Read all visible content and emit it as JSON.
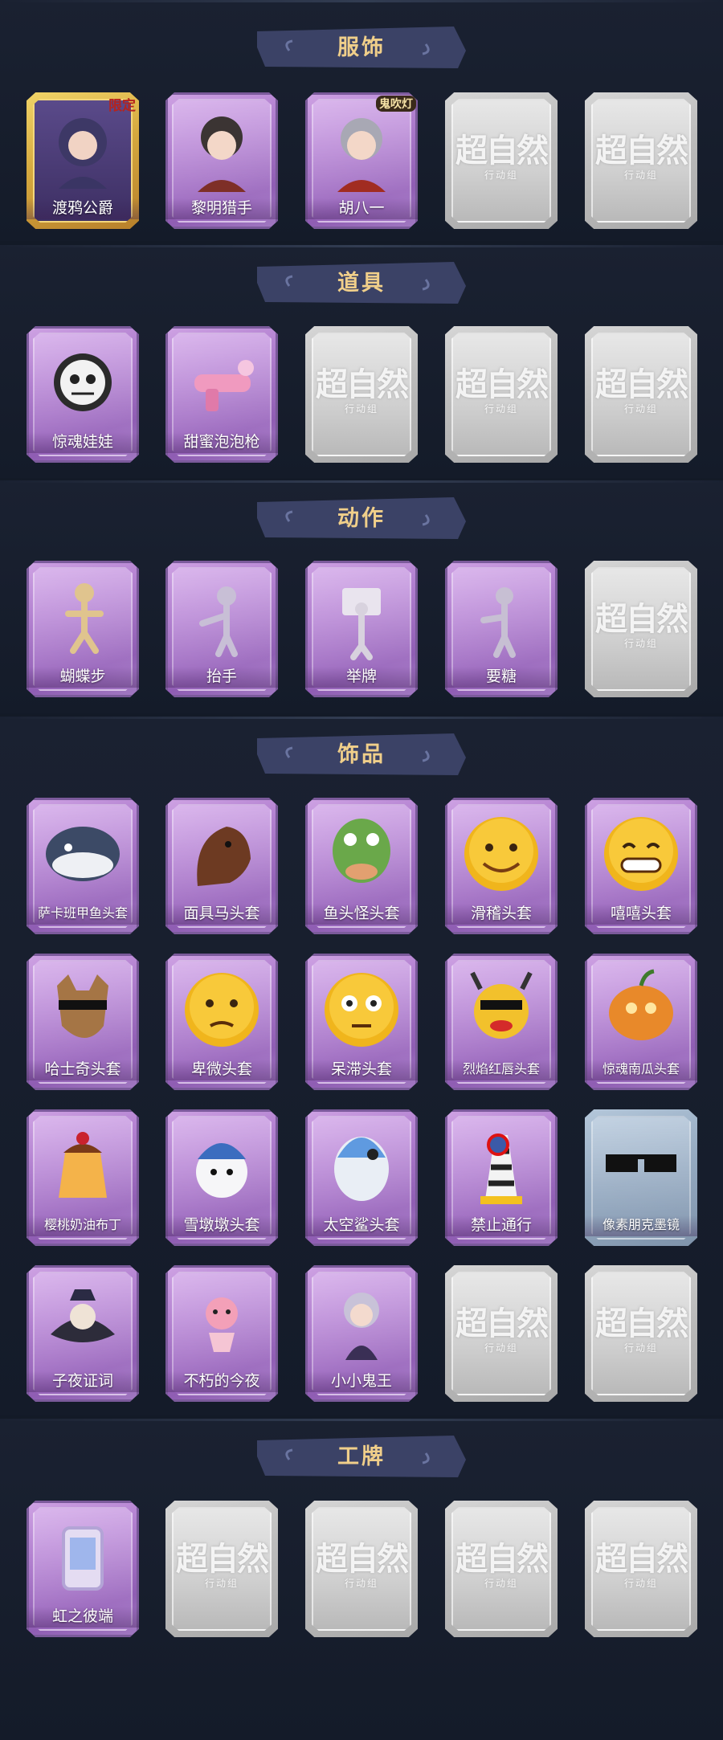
{
  "sections": [
    {
      "title": "服饰",
      "items": [
        {
          "label": "渡鸦公爵",
          "style": "gold",
          "icon": "portrait-duke-icon",
          "badge": "限定"
        },
        {
          "label": "黎明猎手",
          "style": "purple",
          "icon": "portrait-hunter-icon"
        },
        {
          "label": "胡八一",
          "style": "purple",
          "icon": "portrait-hubayi-icon",
          "badge": "鬼吹灯"
        },
        {
          "label": "",
          "style": "locked",
          "icon": "locked-placeholder-icon"
        },
        {
          "label": "",
          "style": "locked",
          "icon": "locked-placeholder-icon"
        }
      ]
    },
    {
      "title": "道具",
      "items": [
        {
          "label": "惊魂娃娃",
          "style": "purple",
          "icon": "skull-doll-icon"
        },
        {
          "label": "甜蜜泡泡枪",
          "style": "purple",
          "icon": "bubble-gun-icon"
        },
        {
          "label": "",
          "style": "locked",
          "icon": "locked-placeholder-icon"
        },
        {
          "label": "",
          "style": "locked",
          "icon": "locked-placeholder-icon"
        },
        {
          "label": "",
          "style": "locked",
          "icon": "locked-placeholder-icon"
        }
      ]
    },
    {
      "title": "动作",
      "items": [
        {
          "label": "蝴蝶步",
          "style": "purple",
          "icon": "butterfly-step-icon"
        },
        {
          "label": "抬手",
          "style": "purple",
          "icon": "raise-hand-icon"
        },
        {
          "label": "举牌",
          "style": "purple",
          "icon": "hold-sign-icon"
        },
        {
          "label": "要糖",
          "style": "purple",
          "icon": "ask-candy-icon"
        },
        {
          "label": "",
          "style": "locked",
          "icon": "locked-placeholder-icon"
        }
      ]
    },
    {
      "title": "饰品",
      "items": [
        {
          "label": "萨卡班甲鱼头套",
          "style": "purple",
          "icon": "fish-head-icon"
        },
        {
          "label": "面具马头套",
          "style": "purple",
          "icon": "horse-head-icon"
        },
        {
          "label": "鱼头怪头套",
          "style": "purple",
          "icon": "green-fish-head-icon"
        },
        {
          "label": "滑稽头套",
          "style": "purple",
          "icon": "funny-face-icon"
        },
        {
          "label": "嘻嘻头套",
          "style": "purple",
          "icon": "grin-face-icon"
        },
        {
          "label": "哈士奇头套",
          "style": "purple",
          "icon": "husky-head-icon"
        },
        {
          "label": "卑微头套",
          "style": "purple",
          "icon": "humble-face-icon"
        },
        {
          "label": "呆滞头套",
          "style": "purple",
          "icon": "blank-face-icon"
        },
        {
          "label": "烈焰红唇头套",
          "style": "purple",
          "icon": "red-lips-head-icon"
        },
        {
          "label": "惊魂南瓜头套",
          "style": "purple",
          "icon": "pumpkin-head-icon"
        },
        {
          "label": "樱桃奶油布丁",
          "style": "purple",
          "icon": "pudding-icon"
        },
        {
          "label": "雪墩墩头套",
          "style": "purple",
          "icon": "snowman-head-icon"
        },
        {
          "label": "太空鲨头套",
          "style": "purple",
          "icon": "space-shark-icon"
        },
        {
          "label": "禁止通行",
          "style": "purple",
          "icon": "no-entry-cone-icon"
        },
        {
          "label": "像素朋克墨镜",
          "style": "blue",
          "icon": "pixel-sunglasses-icon"
        },
        {
          "label": "子夜证词",
          "style": "purple",
          "icon": "midnight-testimony-icon"
        },
        {
          "label": "不朽的今夜",
          "style": "purple",
          "icon": "immortal-tonight-icon"
        },
        {
          "label": "小小鬼王",
          "style": "purple",
          "icon": "little-ghost-king-icon"
        },
        {
          "label": "",
          "style": "locked",
          "icon": "locked-placeholder-icon"
        },
        {
          "label": "",
          "style": "locked",
          "icon": "locked-placeholder-icon"
        }
      ]
    },
    {
      "title": "工牌",
      "items": [
        {
          "label": "虹之彼端",
          "style": "purple",
          "icon": "rainbow-badge-icon"
        },
        {
          "label": "",
          "style": "locked",
          "icon": "locked-placeholder-icon"
        },
        {
          "label": "",
          "style": "locked",
          "icon": "locked-placeholder-icon"
        },
        {
          "label": "",
          "style": "locked",
          "icon": "locked-placeholder-icon"
        },
        {
          "label": "",
          "style": "locked",
          "icon": "locked-placeholder-icon"
        }
      ]
    }
  ],
  "locked_text": {
    "main": "超自然",
    "sub": "行动组"
  },
  "colors": {
    "background": "#131a27",
    "ribbon": "#3b4266",
    "title": "#f0cf8a",
    "purple_card": "#b17fcf",
    "gold_card": "#d6a93f",
    "locked_card": "#bdbdbd"
  }
}
